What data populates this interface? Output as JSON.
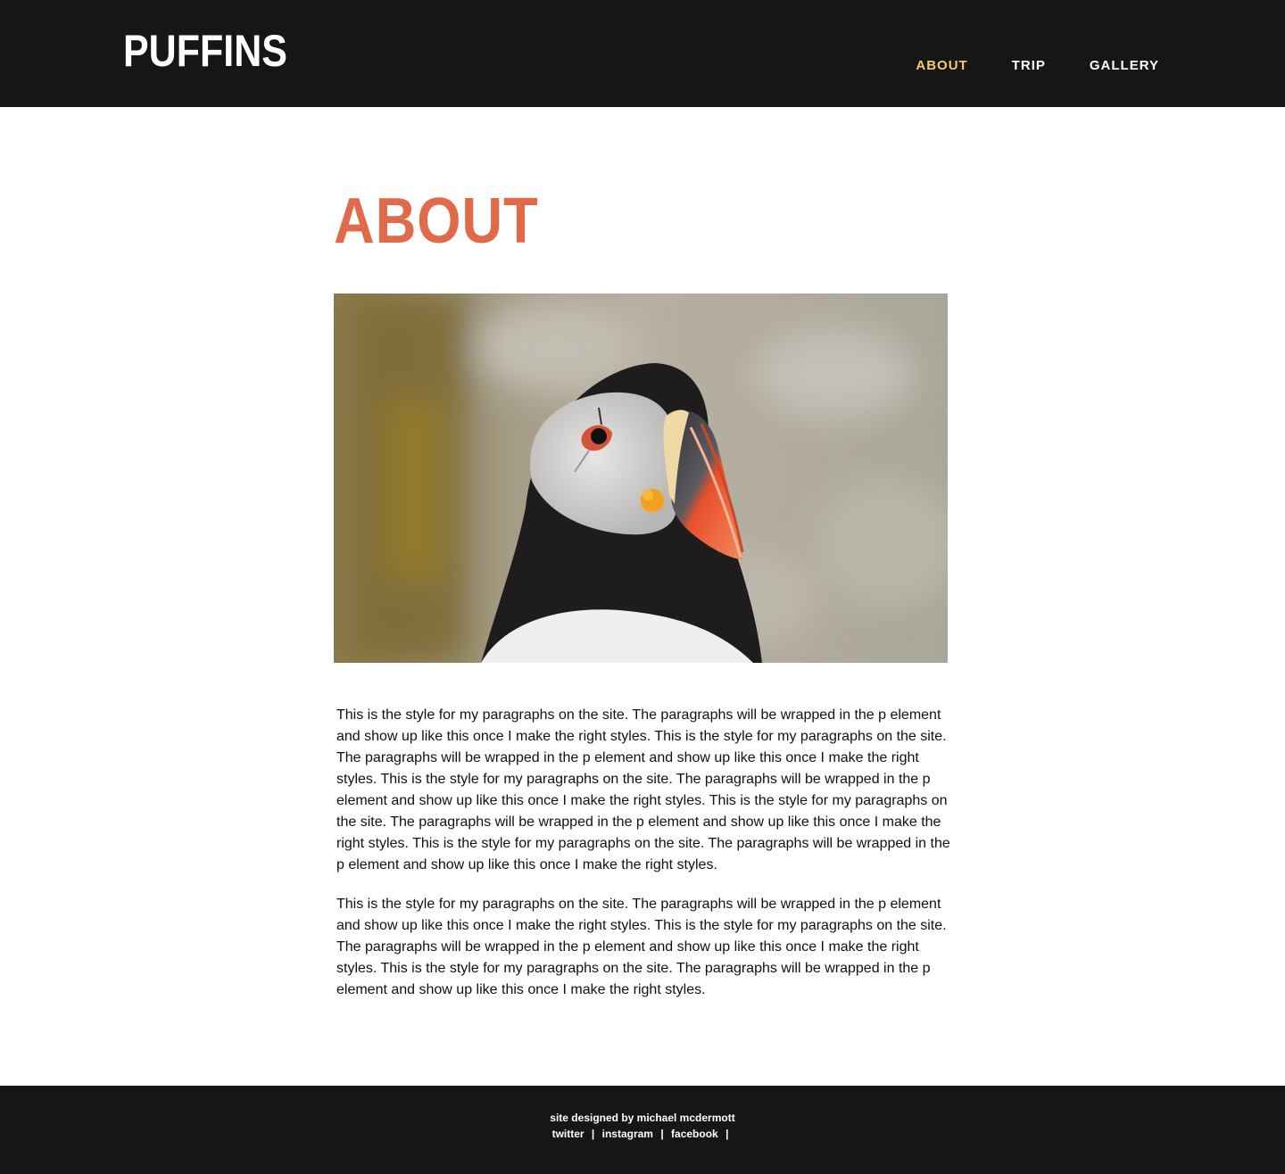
{
  "header": {
    "logo": "PUFFINS",
    "nav": [
      {
        "label": "ABOUT",
        "active": true
      },
      {
        "label": "TRIP",
        "active": false
      },
      {
        "label": "GALLERY",
        "active": false
      }
    ]
  },
  "main": {
    "heading": "ABOUT",
    "hero_image": {
      "alt": "puffin-photo"
    },
    "paragraphs": [
      "This is the style for my paragraphs on the site. The paragraphs will be wrapped in the p element and show up like this once I make the right styles. This is the style for my paragraphs on the site. The paragraphs will be wrapped in the p element and show up like this once I make the right styles. This is the style for my paragraphs on the site. The paragraphs will be wrapped in the p element and show up like this once I make the right styles. This is the style for my paragraphs on the site. The paragraphs will be wrapped in the p element and show up like this once I make the right styles. This is the style for my paragraphs on the site. The paragraphs will be wrapped in the p element and show up like this once I make the right styles.",
      "This is the style for my paragraphs on the site. The paragraphs will be wrapped in the p element and show up like this once I make the right styles. This is the style for my paragraphs on the site. The paragraphs will be wrapped in the p element and show up like this once I make the right styles. This is the style for my paragraphs on the site. The paragraphs will be wrapped in the p element and show up like this once I make the right styles."
    ]
  },
  "footer": {
    "credit": "site designed by michael mcdermott",
    "links": [
      {
        "label": "twitter"
      },
      {
        "label": "instagram"
      },
      {
        "label": "facebook"
      }
    ],
    "separator": "|"
  },
  "colors": {
    "header_bg": "#161616",
    "active_nav": "#f6cc6f",
    "heading": "#e06a4a"
  }
}
